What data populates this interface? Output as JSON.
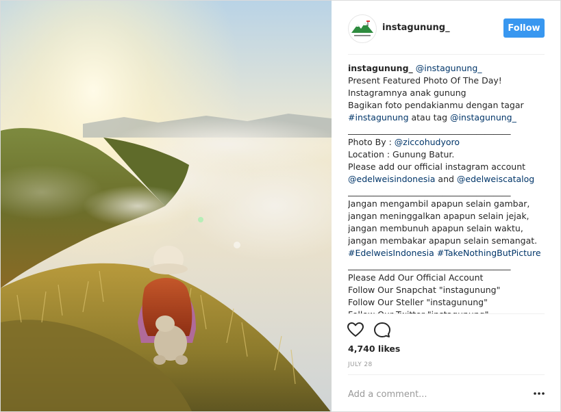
{
  "post": {
    "author": "instagunung_",
    "follow_label": "Follow",
    "caption": [
      {
        "parts": [
          {
            "t": "instagunung_",
            "k": "user"
          },
          {
            "t": " "
          },
          {
            "t": "@instagunung_",
            "k": "link"
          }
        ]
      },
      {
        "parts": [
          {
            "t": "Present Featured Photo Of The Day!"
          }
        ]
      },
      {
        "parts": [
          {
            "t": "Instagramnya anak gunung"
          }
        ]
      },
      {
        "parts": [
          {
            "t": "Bagikan foto pendakianmu dengan tagar"
          }
        ]
      },
      {
        "parts": [
          {
            "t": "#instagunung",
            "k": "link"
          },
          {
            "t": " atau tag "
          },
          {
            "t": "@instagunung_",
            "k": "link"
          }
        ]
      },
      {
        "parts": [
          {
            "t": "______________________________________"
          }
        ]
      },
      {
        "parts": [
          {
            "t": "Photo By : "
          },
          {
            "t": "@ziccohudyoro",
            "k": "link"
          }
        ]
      },
      {
        "parts": [
          {
            "t": "Location : Gunung Batur."
          }
        ]
      },
      {
        "parts": [
          {
            "t": "Please add our official instagram account"
          }
        ]
      },
      {
        "parts": [
          {
            "t": "@edelweisindonesia",
            "k": "link"
          },
          {
            "t": " and "
          },
          {
            "t": "@edelweiscatalog",
            "k": "link"
          }
        ]
      },
      {
        "parts": [
          {
            "t": "______________________________________"
          }
        ]
      },
      {
        "parts": [
          {
            "t": "Jangan mengambil apapun selain gambar,"
          }
        ]
      },
      {
        "parts": [
          {
            "t": "jangan meninggalkan apapun selain jejak,"
          }
        ]
      },
      {
        "parts": [
          {
            "t": "jangan membunuh apapun selain waktu,"
          }
        ]
      },
      {
        "parts": [
          {
            "t": "jangan membakar apapun selain semangat."
          }
        ]
      },
      {
        "parts": [
          {
            "t": "#EdelweisIndonesia",
            "k": "link"
          },
          {
            "t": " "
          },
          {
            "t": "#TakeNothingButPicture",
            "k": "link"
          }
        ]
      },
      {
        "parts": [
          {
            "t": "______________________________________"
          }
        ]
      },
      {
        "parts": [
          {
            "t": "Please Add Our Official Account"
          }
        ]
      },
      {
        "parts": [
          {
            "t": "Follow Our Snapchat \"instagunung\""
          }
        ]
      },
      {
        "parts": [
          {
            "t": "Follow Our Steller \"instagunung\""
          }
        ]
      },
      {
        "parts": [
          {
            "t": "Follow Our Twitter \"instagunung\""
          }
        ]
      }
    ],
    "likes_text": "4,740 likes",
    "date_text": "JULY 28",
    "comment_placeholder": "Add a comment...",
    "icons": {
      "like": "heart-icon",
      "comment": "comment-icon",
      "more": "more-options-icon"
    },
    "colors": {
      "follow_button": "#3897f0",
      "link": "#003569",
      "muted": "#999999"
    }
  }
}
